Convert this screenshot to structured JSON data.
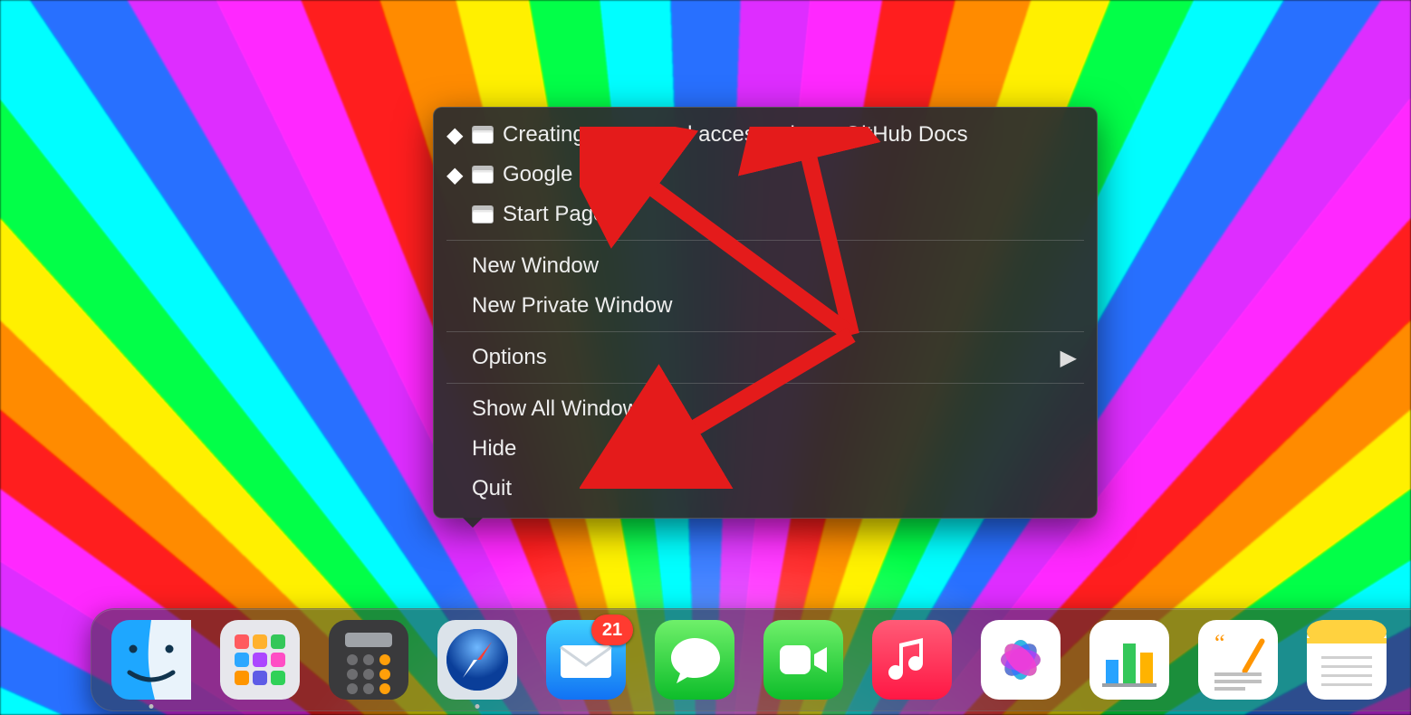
{
  "menu": {
    "windows": [
      {
        "label": "Creating a personal access token - GitHub Docs",
        "diamond": true
      },
      {
        "label": "Google",
        "diamond": true
      },
      {
        "label": "Start Page",
        "diamond": false
      }
    ],
    "newWindow": "New Window",
    "newPrivate": "New Private Window",
    "options": "Options",
    "showAll": "Show All Windows",
    "hide": "Hide",
    "quit": "Quit"
  },
  "dock": {
    "finder": {
      "name": "Finder",
      "running": true
    },
    "launchpad": {
      "name": "Launchpad",
      "running": false
    },
    "calculator": {
      "name": "Calculator",
      "running": false
    },
    "safari": {
      "name": "Safari",
      "running": true
    },
    "mail": {
      "name": "Mail",
      "running": false,
      "badge": "21"
    },
    "messages": {
      "name": "Messages",
      "running": false
    },
    "facetime": {
      "name": "FaceTime",
      "running": false
    },
    "music": {
      "name": "Music",
      "running": false
    },
    "photos": {
      "name": "Photos",
      "running": false
    },
    "numbers": {
      "name": "Numbers",
      "running": false
    },
    "pages": {
      "name": "Pages",
      "running": false
    },
    "notes": {
      "name": "Notes",
      "running": false
    }
  }
}
